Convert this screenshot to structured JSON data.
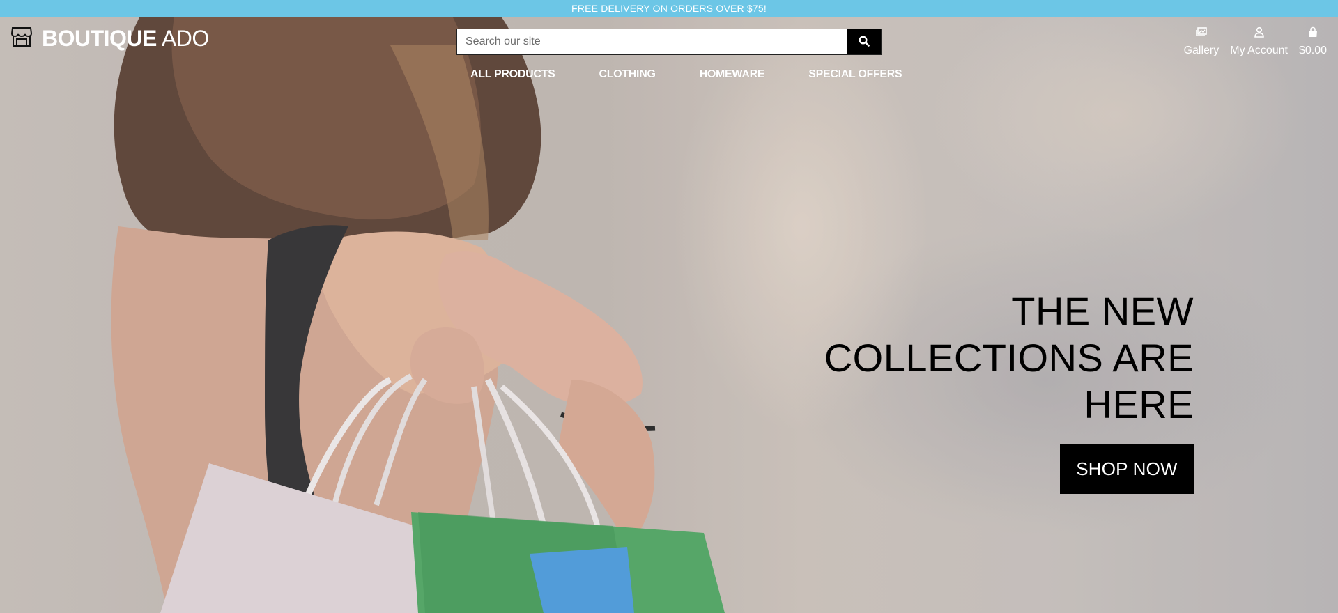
{
  "promo_banner": {
    "text": "FREE DELIVERY ON ORDERS OVER $75!"
  },
  "brand": {
    "name_bold": "BOUTIQUE",
    "name_light": "ADO",
    "icon": "store-icon"
  },
  "search": {
    "placeholder": "Search our site",
    "value": "",
    "button_icon": "search-icon"
  },
  "main_nav": {
    "items": [
      {
        "label": "ALL PRODUCTS"
      },
      {
        "label": "CLOTHING"
      },
      {
        "label": "HOMEWARE"
      },
      {
        "label": "SPECIAL OFFERS"
      }
    ]
  },
  "user_nav": {
    "gallery": {
      "label": "Gallery",
      "icon": "gallery-icon"
    },
    "account": {
      "label": "My Account",
      "icon": "user-icon"
    },
    "bag": {
      "label": "$0.00",
      "icon": "shopping-bag-icon"
    }
  },
  "hero": {
    "headline": "THE NEW COLLECTIONS ARE HERE",
    "cta_label": "SHOP NOW",
    "image": "woman-with-shopping-bags-photo"
  },
  "colors": {
    "banner_bg": "#6cc6e6",
    "button_bg": "#000000",
    "text_light": "#ffffff"
  }
}
